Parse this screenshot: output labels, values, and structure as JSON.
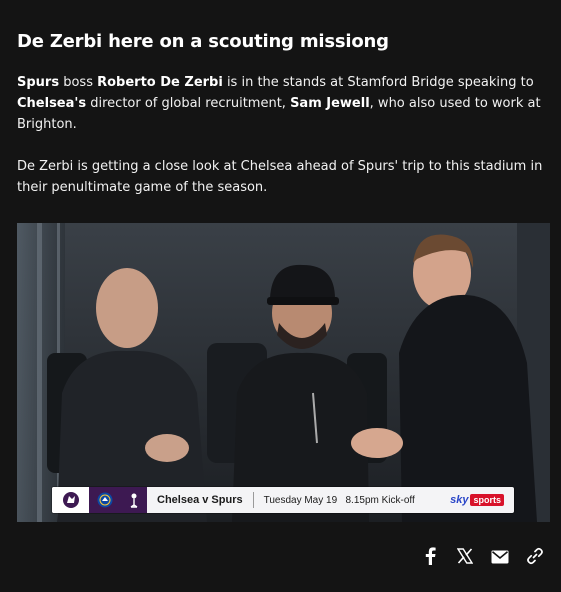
{
  "article": {
    "headline": "De Zerbi here on a scouting missiong",
    "paragraph1": {
      "t1": "Spurs",
      "t2": " boss ",
      "t3": "Roberto De Zerbi",
      "t4": " is in the stands at Stamford Bridge speaking to ",
      "t5": "Chelsea's",
      "t6": " director of global recruitment, ",
      "t7": "Sam Jewell",
      "t8": ", who also used to work at Brighton."
    },
    "paragraph2": "De Zerbi is getting a close look at Chelsea ahead of Spurs' trip to this stadium in their penultimate game of the season."
  },
  "broadcast_banner": {
    "fixture": "Chelsea v Spurs",
    "kickoff": "Tuesday May 19   8.15pm Kick-off",
    "broadcaster_sky": "sky",
    "broadcaster_sports": "sports"
  },
  "share": {
    "icons": [
      "facebook-icon",
      "x-icon",
      "email-icon",
      "link-icon"
    ]
  },
  "colors": {
    "background": "#141414",
    "text": "#ffffff"
  }
}
